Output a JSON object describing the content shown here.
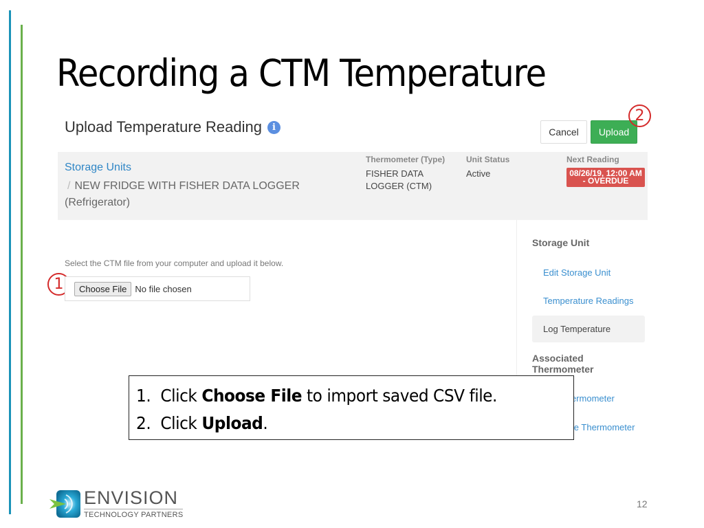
{
  "slide": {
    "title": "Recording a CTM Temperature",
    "page_number": "12",
    "callouts": [
      "1",
      "2"
    ],
    "accent_colors": {
      "line_blue": "#1a93b8",
      "line_green": "#6ab04c",
      "callout_red": "#d42a2a"
    }
  },
  "app": {
    "page_title": "Upload Temperature Reading",
    "info_icon": "info-icon",
    "buttons": {
      "cancel": "Cancel",
      "upload": "Upload"
    },
    "breadcrumb": {
      "parent": "Storage Units",
      "separator": "/",
      "current": "NEW FRIDGE WITH FISHER DATA LOGGER (Refrigerator)"
    },
    "meta": {
      "thermometer_label": "Thermometer (Type)",
      "thermometer_value": "FISHER DATA LOGGER (CTM)",
      "status_label": "Unit Status",
      "status_value": "Active",
      "next_reading_label": "Next Reading",
      "next_reading_value": "08/26/19, 12:00 AM - OVERDUE",
      "overdue_color": "#d9534f"
    },
    "upload": {
      "instruction": "Select the CTM file from your computer and upload it below.",
      "choose_file_label": "Choose File",
      "no_file_text": "No file chosen"
    },
    "sidebar": {
      "storage_unit_heading": "Storage Unit",
      "storage_unit_links": [
        "Edit Storage Unit",
        "Temperature Readings"
      ],
      "active_item": "Log Temperature",
      "thermometer_heading": "Associated Thermometer",
      "thermometer_links": [
        "Edit Thermometer",
        "Calibrate Thermometer"
      ]
    },
    "upload_button_color": "#3dae55",
    "link_color": "#2f86c6"
  },
  "note": {
    "steps": [
      {
        "num": "1.",
        "prefix": "Click ",
        "bold": "Choose File",
        "suffix": " to import saved CSV file."
      },
      {
        "num": "2.",
        "prefix": "Click ",
        "bold": "Upload",
        "suffix": "."
      }
    ]
  },
  "logo": {
    "name": "ENVISION",
    "tagline": "TECHNOLOGY PARTNERS"
  }
}
